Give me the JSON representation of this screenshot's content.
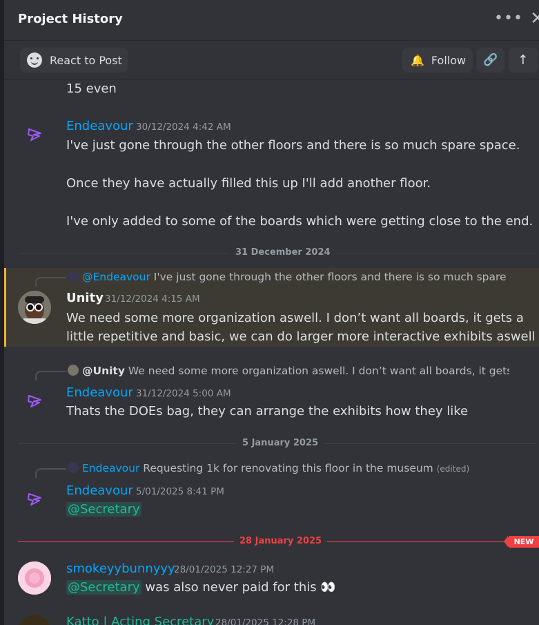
{
  "header": {
    "title": "Project History",
    "more_label": "•••",
    "close_label": "✕"
  },
  "toolbar": {
    "react_label": "React to Post",
    "follow_label": "Follow"
  },
  "messages": {
    "m0": {
      "text": "15 even"
    },
    "m1": {
      "author": "Endeavour",
      "timestamp": "30/12/2024 4:42 AM",
      "lines": [
        "I've just gone through the other floors and there is so much spare space.",
        "Once they have actually filled this up I'll add another floor.",
        "I've only added to some of the boards which were getting close to the end."
      ]
    },
    "d1": "31 December 2024",
    "m2": {
      "reply_author": "@Endeavour",
      "reply_text": "I've just gone through the other floors and there is so much spare s...",
      "author": "Unity",
      "timestamp": "31/12/2024 4:15 AM",
      "lines": [
        "We need some more organization aswell. I don’t want all boards, it gets a",
        "little repetitive and basic, we can do larger more interactive exhibits aswell"
      ]
    },
    "m3": {
      "reply_author": "@Unity",
      "reply_text": "We need some more organization aswell. I don’t want all boards, it gets a ...",
      "author": "Endeavour",
      "timestamp": "31/12/2024 5:00 AM",
      "text": "Thats the DOEs bag, they can arrange the exhibits how they like"
    },
    "d2": "5 January 2025",
    "m4": {
      "reply_author": "Endeavour",
      "reply_text": "Requesting 1k for renovating this floor in the museum",
      "reply_edited": "(edited)",
      "author": "Endeavour",
      "timestamp": "5/01/2025 8:41 PM",
      "mention": "@Secretary"
    },
    "d3": "28 January 2025",
    "new_badge": "NEW",
    "m5": {
      "author": "smokeyybunnyyy",
      "timestamp": "28/01/2025 12:27 PM",
      "mention": "@Secretary",
      "text": "was also never paid for this 👀"
    },
    "m6": {
      "author": "Katto | Acting Secretary",
      "timestamp": "28/01/2025 12:28 PM"
    }
  },
  "colors": {
    "background": "#313338",
    "link_blue": "#00a8fc",
    "highlight": "#3d3a33",
    "highlight_border": "#f0b232",
    "new_red": "#f23f43",
    "role_mention": "#1abc9c"
  },
  "icons": [
    "smile-icon",
    "bell-icon",
    "link-icon",
    "arrow-up-icon",
    "bird-avatar-icon",
    "more-icon",
    "close-icon"
  ]
}
